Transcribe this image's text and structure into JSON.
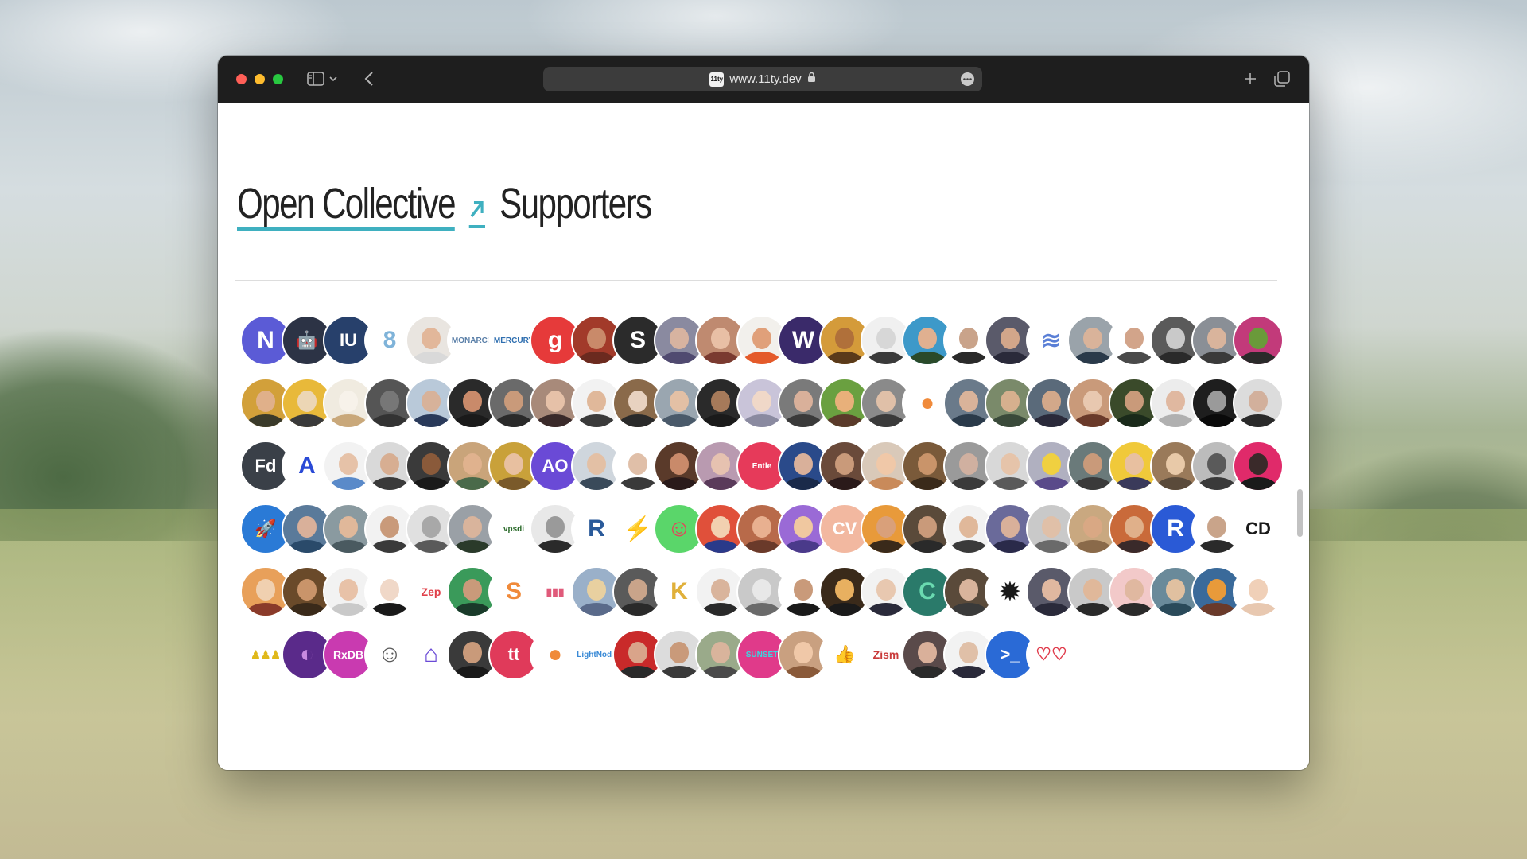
{
  "browser": {
    "url": "www.11ty.dev",
    "favicon_text": "11ty",
    "icons": {
      "sidebar": "sidebar-icon",
      "chevron": "chevron-down-icon",
      "back": "back-arrow-icon",
      "lock": "lock-icon",
      "more": "ellipsis-icon",
      "new_tab": "plus-icon",
      "tabs": "tab-overview-icon"
    }
  },
  "page": {
    "link_text": "Open Collective",
    "arrow": "↗",
    "heading_rest": "Supporters",
    "accent_color": "#3fb0c0"
  },
  "supporters": [
    {
      "kind": "logo",
      "bg": "#5b5bd6",
      "fg": "#ffffff",
      "text": "N"
    },
    {
      "kind": "logo",
      "bg": "#2c3345",
      "fg": "#ffffff",
      "text": "🤖"
    },
    {
      "kind": "logo",
      "bg": "#27406b",
      "fg": "#ffffff",
      "text": "IU"
    },
    {
      "kind": "logo",
      "bg": "#ffffff",
      "fg": "#7fb3d9",
      "text": "8",
      "plain": true
    },
    {
      "kind": "person",
      "bg": "#e9e5e0",
      "skin": "#e2b79a",
      "shirt": "#d9d9d9"
    },
    {
      "kind": "logo",
      "bg": "#ffffff",
      "fg": "#5a7fa8",
      "text": "MONARCH",
      "plain": true
    },
    {
      "kind": "logo",
      "bg": "#ffffff",
      "fg": "#2f6fb0",
      "text": "MERCURY",
      "plain": true
    },
    {
      "kind": "logo",
      "bg": "#e63a3a",
      "fg": "#ffffff",
      "text": "g"
    },
    {
      "kind": "person",
      "bg": "#a23a2a",
      "skin": "#c98a6a",
      "shirt": "#6b2a1f"
    },
    {
      "kind": "logo",
      "bg": "#2b2b2b",
      "fg": "#ffffff",
      "text": "S"
    },
    {
      "kind": "person",
      "bg": "#8a8aa0",
      "skin": "#d7b3a0",
      "shirt": "#504a70"
    },
    {
      "kind": "person",
      "bg": "#bf8a70",
      "skin": "#e8bfa5",
      "shirt": "#7a3a30"
    },
    {
      "kind": "person",
      "bg": "#f2f0ec",
      "skin": "#e0a07a",
      "shirt": "#e45a2a"
    },
    {
      "kind": "logo",
      "bg": "#3a2a6a",
      "fg": "#ffffff",
      "text": "W"
    },
    {
      "kind": "person",
      "bg": "#d49b3a",
      "skin": "#b0703a",
      "shirt": "#5a3a1a"
    },
    {
      "kind": "person",
      "bg": "#f0f0f0",
      "skin": "#d7d7d7",
      "shirt": "#3a3a3a"
    },
    {
      "kind": "person",
      "bg": "#3d99c9",
      "skin": "#e0b090",
      "shirt": "#2a4a2a"
    },
    {
      "kind": "person",
      "bg": "#ffffff",
      "skin": "#c9a38a",
      "shirt": "#2a2a2a"
    },
    {
      "kind": "person",
      "bg": "#5a5a6a",
      "skin": "#d2a68a",
      "shirt": "#2a2a3a"
    },
    {
      "kind": "logo",
      "bg": "#ffffff",
      "fg": "#5a7fd6",
      "text": "≋",
      "plain": true
    },
    {
      "kind": "person",
      "bg": "#9aa3aa",
      "skin": "#d9b39a",
      "shirt": "#2a3a4a"
    },
    {
      "kind": "person",
      "bg": "#ffffff",
      "skin": "#d2a48a",
      "shirt": "#4a4a4a"
    },
    {
      "kind": "person",
      "bg": "#5a5a5a",
      "skin": "#c9c9c9",
      "shirt": "#2a2a2a"
    },
    {
      "kind": "person",
      "bg": "#8a8f96",
      "skin": "#d9b49c",
      "shirt": "#3a3a3a"
    },
    {
      "kind": "person",
      "bg": "#c23a7a",
      "skin": "#6a9a3a",
      "shirt": "#2a2a2a"
    },
    {
      "kind": "person",
      "bg": "#d2a03a",
      "skin": "#e0b08a",
      "shirt": "#3a3a2a"
    },
    {
      "kind": "person",
      "bg": "#e8b93a",
      "skin": "#ecd6b5",
      "shirt": "#3a3a3a"
    },
    {
      "kind": "person",
      "bg": "#f0ebe0",
      "skin": "#f7f2ea",
      "shirt": "#c9a87a"
    },
    {
      "kind": "person",
      "bg": "#555555",
      "skin": "#777777",
      "shirt": "#333333"
    },
    {
      "kind": "person",
      "bg": "#b9c9d9",
      "skin": "#d7b29a",
      "shirt": "#2a3a5a"
    },
    {
      "kind": "person",
      "bg": "#2a2a2a",
      "skin": "#c98a6a",
      "shirt": "#1a1a1a"
    },
    {
      "kind": "person",
      "bg": "#6a6a6a",
      "skin": "#c99a7a",
      "shirt": "#2a2a2a"
    },
    {
      "kind": "person",
      "bg": "#a88a7a",
      "skin": "#e6c1a8",
      "shirt": "#3a2a2a"
    },
    {
      "kind": "person",
      "bg": "#f2f2f2",
      "skin": "#e0b89a",
      "shirt": "#3a3a3a"
    },
    {
      "kind": "person",
      "bg": "#8a6a4a",
      "skin": "#e8d2c0",
      "shirt": "#2a2a2a"
    },
    {
      "kind": "person",
      "bg": "#9aa6b0",
      "skin": "#e3c0a5",
      "shirt": "#4a5a6a"
    },
    {
      "kind": "person",
      "bg": "#2a2a2a",
      "skin": "#a67a5a",
      "shirt": "#1a1a1a"
    },
    {
      "kind": "person",
      "bg": "#c9c4d9",
      "skin": "#f0d8c8",
      "shirt": "#8a8aa0"
    },
    {
      "kind": "person",
      "bg": "#7a7a7a",
      "skin": "#d9b09a",
      "shirt": "#3a3a3a"
    },
    {
      "kind": "person",
      "bg": "#6aa040",
      "skin": "#e8b07a",
      "shirt": "#5a3a2a"
    },
    {
      "kind": "person",
      "bg": "#8a8a8a",
      "skin": "#e0c0a8",
      "shirt": "#3a3a3a"
    },
    {
      "kind": "logo",
      "bg": "#ffffff",
      "fg": "#f08a3a",
      "text": "●",
      "plain": true
    },
    {
      "kind": "person",
      "bg": "#6a7a8a",
      "skin": "#d9b39a",
      "shirt": "#2a3a4a"
    },
    {
      "kind": "person",
      "bg": "#7a8a6a",
      "skin": "#d6b08e",
      "shirt": "#3a4a3a"
    },
    {
      "kind": "person",
      "bg": "#5a6a7a",
      "skin": "#d2a88a",
      "shirt": "#2a2a3a"
    },
    {
      "kind": "person",
      "bg": "#c99a7a",
      "skin": "#e8c8b0",
      "shirt": "#6a3a2a"
    },
    {
      "kind": "person",
      "bg": "#3a4a2a",
      "skin": "#c99a7a",
      "shirt": "#1a2a1a"
    },
    {
      "kind": "person",
      "bg": "#ececec",
      "skin": "#e0b8a0",
      "shirt": "#b0b0b0"
    },
    {
      "kind": "person",
      "bg": "#1e1e1e",
      "skin": "#9a9a9a",
      "shirt": "#0a0a0a"
    },
    {
      "kind": "person",
      "bg": "#dcdcdc",
      "skin": "#d2b09c",
      "shirt": "#2a2a2a"
    },
    {
      "kind": "logo",
      "bg": "#3a4048",
      "fg": "#ffffff",
      "text": "Fd"
    },
    {
      "kind": "logo",
      "bg": "#ffffff",
      "fg": "#2a4ad6",
      "text": "A",
      "plain": true
    },
    {
      "kind": "person",
      "bg": "#f2f2f2",
      "skin": "#e6c2a8",
      "shirt": "#5a8ac9"
    },
    {
      "kind": "person",
      "bg": "#d9d9d9",
      "skin": "#d7ae92",
      "shirt": "#3a3a3a"
    },
    {
      "kind": "person",
      "bg": "#3a3a3a",
      "skin": "#8a5a3a",
      "shirt": "#1a1a1a"
    },
    {
      "kind": "person",
      "bg": "#c9a47a",
      "skin": "#e0b28e",
      "shirt": "#4a6a4a"
    },
    {
      "kind": "person",
      "bg": "#c9a13a",
      "skin": "#e8c0a0",
      "shirt": "#7a5a2a"
    },
    {
      "kind": "logo",
      "bg": "#6a4ad6",
      "fg": "#ffffff",
      "text": "AO"
    },
    {
      "kind": "person",
      "bg": "#cfd6dd",
      "skin": "#e3c0a5",
      "shirt": "#3a4a5a"
    },
    {
      "kind": "person",
      "bg": "#ffffff",
      "skin": "#e0bfa8",
      "shirt": "#3a3a3a"
    },
    {
      "kind": "person",
      "bg": "#5a3a2a",
      "skin": "#c98a6a",
      "shirt": "#2a1a1a"
    },
    {
      "kind": "person",
      "bg": "#b99ab0",
      "skin": "#e6c2b0",
      "shirt": "#5a3a5a"
    },
    {
      "kind": "logo",
      "bg": "#e63a5a",
      "fg": "#ffffff",
      "text": "Entle"
    },
    {
      "kind": "person",
      "bg": "#2a4a8a",
      "skin": "#d9b09a",
      "shirt": "#1a2a4a"
    },
    {
      "kind": "person",
      "bg": "#6a4a3a",
      "skin": "#c99a7a",
      "shirt": "#2a1a1a"
    },
    {
      "kind": "person",
      "bg": "#d9c9b9",
      "skin": "#f0c8a8",
      "shirt": "#c98a5a"
    },
    {
      "kind": "person",
      "bg": "#7a5a3a",
      "skin": "#c9946a",
      "shirt": "#3a2a1a"
    },
    {
      "kind": "person",
      "bg": "#9a9a9a",
      "skin": "#d0b0a0",
      "shirt": "#3a3a3a"
    },
    {
      "kind": "person",
      "bg": "#d8d8d8",
      "skin": "#e6c4aa",
      "shirt": "#5a5a5a"
    },
    {
      "kind": "person",
      "bg": "#b0b0c0",
      "skin": "#f0d040",
      "shirt": "#5a4a8a"
    },
    {
      "kind": "person",
      "bg": "#6a7a7a",
      "skin": "#c99a7a",
      "shirt": "#3a3a3a"
    },
    {
      "kind": "person",
      "bg": "#f0c93a",
      "skin": "#e8c0a0",
      "shirt": "#3a3a5a"
    },
    {
      "kind": "person",
      "bg": "#9a7a5a",
      "skin": "#e8c9a8",
      "shirt": "#5a4a3a"
    },
    {
      "kind": "person",
      "bg": "#bcbcbc",
      "skin": "#5a5a5a",
      "shirt": "#3a3a3a"
    },
    {
      "kind": "person",
      "bg": "#e02a6a",
      "skin": "#3a2a2a",
      "shirt": "#1a1a1a"
    },
    {
      "kind": "logo",
      "bg": "#2a7ad6",
      "fg": "#ffffff",
      "text": "🚀"
    },
    {
      "kind": "person",
      "bg": "#5a7a9a",
      "skin": "#d9b09a",
      "shirt": "#2a4a6a"
    },
    {
      "kind": "person",
      "bg": "#8a9aa0",
      "skin": "#e0b89a",
      "shirt": "#4a5a60"
    },
    {
      "kind": "person",
      "bg": "#f2f2f2",
      "skin": "#c99a7a",
      "shirt": "#3a3a3a"
    },
    {
      "kind": "person",
      "bg": "#e0e0e0",
      "skin": "#a8a8a8",
      "shirt": "#5a5a5a"
    },
    {
      "kind": "person",
      "bg": "#9aa0a6",
      "skin": "#d9b49c",
      "shirt": "#2a3a2a"
    },
    {
      "kind": "logo",
      "bg": "#ffffff",
      "fg": "#2a6a2a",
      "text": "vpsdi",
      "plain": true
    },
    {
      "kind": "person",
      "bg": "#e8e8e8",
      "skin": "#9a9a9a",
      "shirt": "#2a2a2a"
    },
    {
      "kind": "logo",
      "bg": "#ffffff",
      "fg": "#2a5a9a",
      "text": "R",
      "plain": true
    },
    {
      "kind": "logo",
      "bg": "#ffffff",
      "fg": "#111111",
      "text": "⚡",
      "plain": true
    },
    {
      "kind": "logo",
      "bg": "#5ad66a",
      "fg": "#e6405a",
      "text": "☺"
    },
    {
      "kind": "person",
      "bg": "#e0503a",
      "skin": "#f2d0b0",
      "shirt": "#2a3a8a"
    },
    {
      "kind": "person",
      "bg": "#b86a4a",
      "skin": "#e8b090",
      "shirt": "#6a3a2a"
    },
    {
      "kind": "person",
      "bg": "#9a6ad6",
      "skin": "#f0c8a0",
      "shirt": "#4a3a8a"
    },
    {
      "kind": "logo",
      "bg": "#f2b8a0",
      "fg": "#ffffff",
      "text": "CV"
    },
    {
      "kind": "person",
      "bg": "#e89a3a",
      "skin": "#d9a07a",
      "shirt": "#3a2a1a"
    },
    {
      "kind": "person",
      "bg": "#5a4a3a",
      "skin": "#c99a7a",
      "shirt": "#2a2a2a"
    },
    {
      "kind": "person",
      "bg": "#f2f2f2",
      "skin": "#e0b89a",
      "shirt": "#3a3a3a"
    },
    {
      "kind": "person",
      "bg": "#6a6a9a",
      "skin": "#d9b09a",
      "shirt": "#2a2a4a"
    },
    {
      "kind": "person",
      "bg": "#c9c9c9",
      "skin": "#e0c0a8",
      "shirt": "#6a6a6a"
    },
    {
      "kind": "person",
      "bg": "#c9a880",
      "skin": "#d9a884",
      "shirt": "#8a6a4a"
    },
    {
      "kind": "person",
      "bg": "#c96a3a",
      "skin": "#e0b08a",
      "shirt": "#3a2a2a"
    },
    {
      "kind": "logo",
      "bg": "#2a5ad6",
      "fg": "#ffffff",
      "text": "R"
    },
    {
      "kind": "person",
      "bg": "#ffffff",
      "skin": "#c9a48a",
      "shirt": "#2a2a2a"
    },
    {
      "kind": "logo",
      "bg": "#ffffff",
      "fg": "#1a1a1a",
      "text": "CD",
      "plain": true
    },
    {
      "kind": "person",
      "bg": "#e8a05a",
      "skin": "#f0d0b0",
      "shirt": "#8a3a2a"
    },
    {
      "kind": "person",
      "bg": "#6a4a2a",
      "skin": "#c9946a",
      "shirt": "#3a2a1a"
    },
    {
      "kind": "person",
      "bg": "#f2f2f2",
      "skin": "#e8c2a8",
      "shirt": "#c9c9c9"
    },
    {
      "kind": "person",
      "bg": "#ffffff",
      "skin": "#f0d8c8",
      "shirt": "#1a1a1a"
    },
    {
      "kind": "logo",
      "bg": "#ffffff",
      "fg": "#e0404a",
      "text": "Zep",
      "plain": true
    },
    {
      "kind": "person",
      "bg": "#3a9a5a",
      "skin": "#c99a7a",
      "shirt": "#1a3a2a"
    },
    {
      "kind": "logo",
      "bg": "#ffffff",
      "fg": "#f08a3a",
      "text": "S",
      "plain": true
    },
    {
      "kind": "logo",
      "bg": "#ffffff",
      "fg": "#e05a7a",
      "text": "▮▮▮",
      "plain": true
    },
    {
      "kind": "person",
      "bg": "#9ab0c9",
      "skin": "#e8d0a0",
      "shirt": "#5a6a8a"
    },
    {
      "kind": "person",
      "bg": "#5a5a5a",
      "skin": "#c9a48a",
      "shirt": "#2a2a2a"
    },
    {
      "kind": "logo",
      "bg": "#ffffff",
      "fg": "#e0b03a",
      "text": "K",
      "plain": true
    },
    {
      "kind": "person",
      "bg": "#f2f2f2",
      "skin": "#d9b49c",
      "shirt": "#2a2a2a"
    },
    {
      "kind": "person",
      "bg": "#c9c9c9",
      "skin": "#e8e8e8",
      "shirt": "#6a6a6a"
    },
    {
      "kind": "person",
      "bg": "#ffffff",
      "skin": "#c99a7a",
      "shirt": "#1a1a1a"
    },
    {
      "kind": "person",
      "bg": "#3a2a1a",
      "skin": "#e8b060",
      "shirt": "#1a1a1a"
    },
    {
      "kind": "person",
      "bg": "#f2f2f2",
      "skin": "#e8c8b0",
      "shirt": "#2a2a3a"
    },
    {
      "kind": "logo",
      "bg": "#2a7a6a",
      "fg": "#6adab0",
      "text": "C"
    },
    {
      "kind": "person",
      "bg": "#5a4a3a",
      "skin": "#d9b49c",
      "shirt": "#3a3a3a"
    },
    {
      "kind": "logo",
      "bg": "#ffffff",
      "fg": "#1a1a1a",
      "text": "✹",
      "plain": true
    },
    {
      "kind": "person",
      "bg": "#5a5a6a",
      "skin": "#e0b8a0",
      "shirt": "#2a2a3a"
    },
    {
      "kind": "person",
      "bg": "#c9c9c9",
      "skin": "#e0b89a",
      "shirt": "#2a2a2a"
    },
    {
      "kind": "person",
      "bg": "#f2c9c9",
      "skin": "#e0b8a0",
      "shirt": "#2a2a2a"
    },
    {
      "kind": "person",
      "bg": "#6a8a9a",
      "skin": "#e0c0a0",
      "shirt": "#2a4a5a"
    },
    {
      "kind": "person",
      "bg": "#3a6a9a",
      "skin": "#e89a3a",
      "shirt": "#6a3a2a"
    },
    {
      "kind": "person",
      "bg": "#ffffff",
      "skin": "#f0d0b8",
      "shirt": "#e8c8b0"
    },
    {
      "kind": "logo",
      "bg": "#ffffff",
      "fg": "#e0b81a",
      "text": "♟♟♟",
      "plain": true
    },
    {
      "kind": "logo",
      "bg": "#5a2a8a",
      "fg": "#c98ae0",
      "text": "◐"
    },
    {
      "kind": "logo",
      "bg": "#c93ab0",
      "fg": "#ffffff",
      "text": "RxDB"
    },
    {
      "kind": "logo",
      "bg": "#ffffff",
      "fg": "#5a5a5a",
      "text": "☺",
      "plain": true
    },
    {
      "kind": "logo",
      "bg": "#ffffff",
      "fg": "#6a4ad6",
      "text": "⌂",
      "plain": true
    },
    {
      "kind": "person",
      "bg": "#3a3a3a",
      "skin": "#c99a7a",
      "shirt": "#1a1a1a"
    },
    {
      "kind": "logo",
      "bg": "#e03a5a",
      "fg": "#ffffff",
      "text": "tt"
    },
    {
      "kind": "logo",
      "bg": "#ffffff",
      "fg": "#f08a3a",
      "text": "●",
      "plain": true
    },
    {
      "kind": "logo",
      "bg": "#ffffff",
      "fg": "#3a8ad6",
      "text": "LightNode",
      "plain": true
    },
    {
      "kind": "person",
      "bg": "#c92a2a",
      "skin": "#d9a48a",
      "shirt": "#2a2a2a"
    },
    {
      "kind": "person",
      "bg": "#dcdcdc",
      "skin": "#c99a7a",
      "shirt": "#3a3a3a"
    },
    {
      "kind": "person",
      "bg": "#9aaa8a",
      "skin": "#d9b49c",
      "shirt": "#4a4a4a"
    },
    {
      "kind": "logo",
      "bg": "#e03a8a",
      "fg": "#3ad6e0",
      "text": "SUNSET"
    },
    {
      "kind": "person",
      "bg": "#c9a080",
      "skin": "#f0c8a8",
      "shirt": "#8a5a3a"
    },
    {
      "kind": "logo",
      "bg": "#ffffff",
      "fg": "#e05aa0",
      "text": "👍",
      "plain": true
    },
    {
      "kind": "logo",
      "bg": "#ffffff",
      "fg": "#c93a3a",
      "text": "Zism",
      "plain": true
    },
    {
      "kind": "person",
      "bg": "#5a4a4a",
      "skin": "#d9b09a",
      "shirt": "#2a2a2a"
    },
    {
      "kind": "person",
      "bg": "#f2f2f2",
      "skin": "#e0c0a8",
      "shirt": "#2a2a3a"
    },
    {
      "kind": "logo",
      "bg": "#2a6ad6",
      "fg": "#ffffff",
      "text": ">_"
    },
    {
      "kind": "logo",
      "bg": "#ffffff",
      "fg": "#e03a4a",
      "text": "♡♡",
      "plain": true
    }
  ]
}
